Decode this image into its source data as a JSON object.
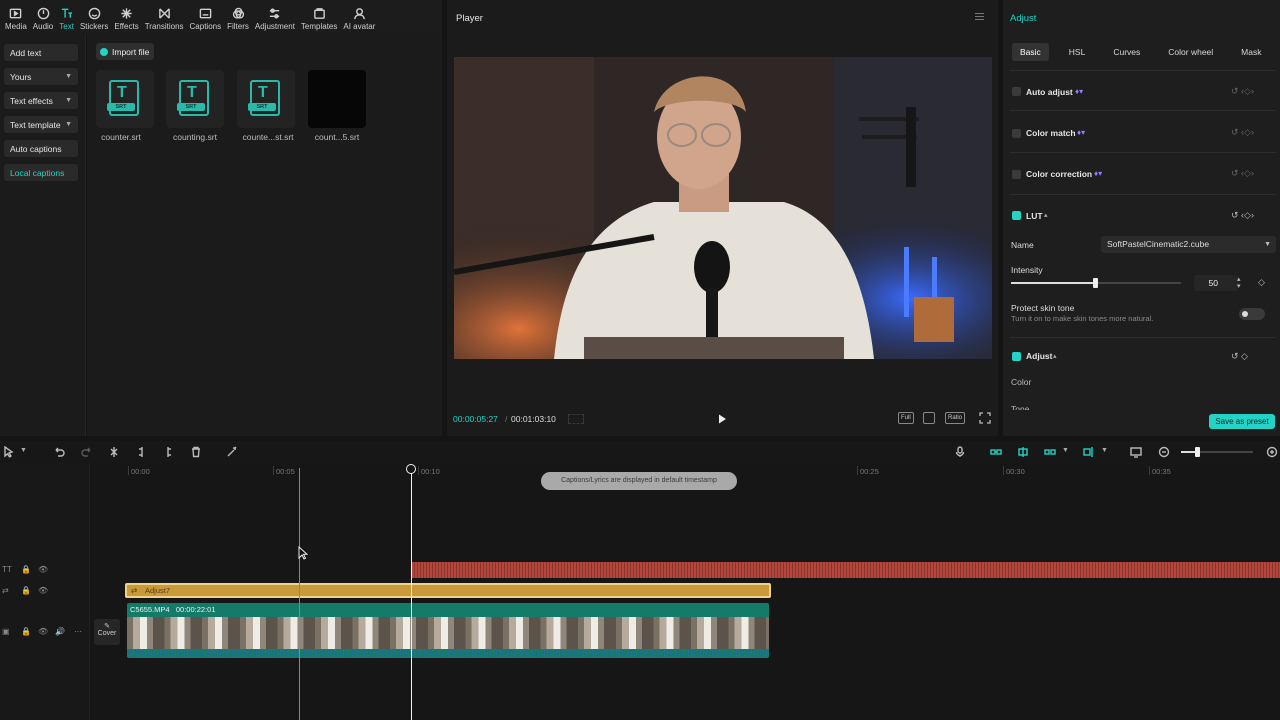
{
  "toolbar": {
    "items": [
      {
        "label": "Media",
        "icon": "media-icon"
      },
      {
        "label": "Audio",
        "icon": "audio-icon"
      },
      {
        "label": "Text",
        "icon": "text-icon",
        "active": true
      },
      {
        "label": "Stickers",
        "icon": "stickers-icon"
      },
      {
        "label": "Effects",
        "icon": "effects-icon"
      },
      {
        "label": "Transitions",
        "icon": "transitions-icon"
      },
      {
        "label": "Captions",
        "icon": "captions-icon"
      },
      {
        "label": "Filters",
        "icon": "filters-icon"
      },
      {
        "label": "Adjustment",
        "icon": "adjustment-icon"
      },
      {
        "label": "Templates",
        "icon": "templates-icon"
      },
      {
        "label": "AI avatar",
        "icon": "ai-avatar-icon"
      }
    ]
  },
  "leftnav": {
    "add_text": "Add text",
    "yours": "Yours",
    "text_effects": "Text effects",
    "text_template": "Text template",
    "auto_captions": "Auto captions",
    "local_captions": "Local captions"
  },
  "assets": {
    "import_label": "Import file",
    "srt_tag": "SRT",
    "items": [
      "counter.srt",
      "counting.srt",
      "counte...st.srt",
      "count...5.srt"
    ]
  },
  "player": {
    "title": "Player",
    "current_time": "00:00:05:27",
    "separator": "/",
    "duration": "00:01:03:10",
    "full_label": "Full",
    "ratio_label": "Ratio"
  },
  "adjust": {
    "title": "Adjust",
    "tabs": [
      "Basic",
      "HSL",
      "Curves",
      "Color wheel",
      "Mask"
    ],
    "active_tab": "Basic",
    "auto_adjust": "Auto adjust",
    "color_match": "Color match",
    "color_correction": "Color correction",
    "lut": "LUT",
    "name_label": "Name",
    "name_value": "SoftPastelCinematic2.cube",
    "intensity_label": "Intensity",
    "intensity_value": "50",
    "intensity_level": 0.5,
    "protect_title": "Protect skin tone",
    "protect_desc": "Turn it on to make skin tones more natural.",
    "adjust_section": "Adjust",
    "color_label": "Color",
    "tone_label": "Tone",
    "save_preset": "Save as preset"
  },
  "timeline": {
    "ruler": [
      "00:00",
      "00:05",
      "00:10",
      "00:25",
      "00:30",
      "00:35"
    ],
    "toast": "Captions/Lyrics are displayed in default timestamp",
    "adjust_clip": "Adjust7",
    "video_clip_name": "C5655.MP4",
    "video_clip_duration": "00:00:22:01",
    "cover_label": "Cover"
  },
  "colors": {
    "accent": "#23d3c6",
    "adjust_clip": "#c89a3a",
    "video_clip": "#147a6a",
    "caption_track": "#b2483c"
  }
}
